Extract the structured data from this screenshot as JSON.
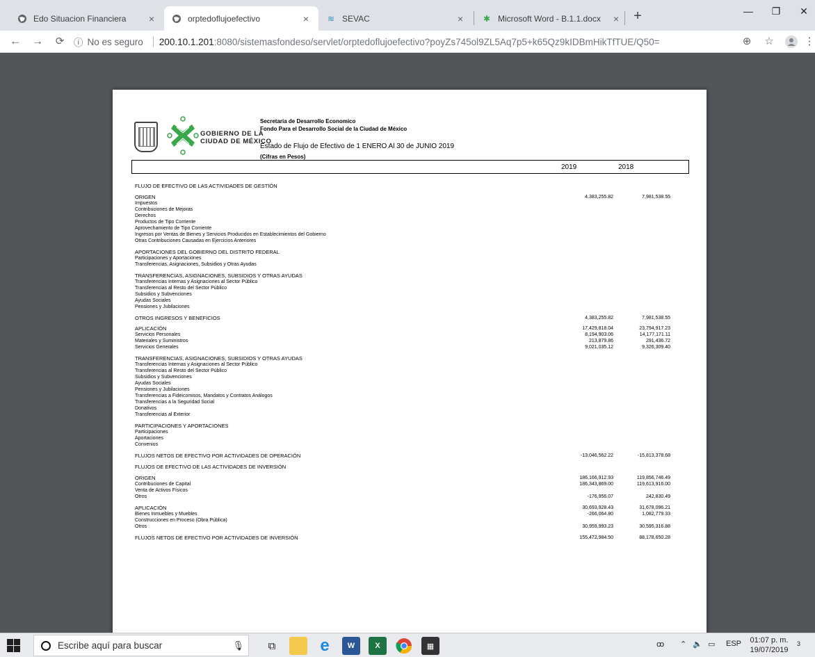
{
  "browser": {
    "tabs": [
      {
        "label": "Edo Situacion Financiera",
        "active": false
      },
      {
        "label": "orptedoflujoefectivo",
        "active": true
      },
      {
        "label": "SEVAC",
        "active": false
      },
      {
        "label": "Microsoft Word - B.1.1.docx",
        "active": false
      }
    ],
    "security_label": "No es seguro",
    "url_host": "200.10.1.201",
    "url_rest": ":8080/sistemasfondeso/servlet/orptedoflujoefectivo?poyZs745ol9ZL5Aq7p5+k65Qz9kIDBmHikTfTUE/Q50="
  },
  "report": {
    "logo_text_line1": "GOBIERNO DE LA",
    "logo_text_line2": "CIUDAD DE MÉXICO",
    "header_line1": "Secretaria de Desarrollo Economico",
    "header_line2": "Fondo Para el Desarrollo Social de la Ciudad de México",
    "title": "Estado de Flujo de Efectivo de 1 ENERO Al 30 de JUNIO 2019",
    "subtitle": "(Cifras en Pesos)",
    "year_current": "2019",
    "year_previous": "2018",
    "rows": [
      {
        "label": "FLUJO DE EFECTIVO DE LAS ACTIVIDADES DE GESTIÓN",
        "v2019": "",
        "v2018": "",
        "heading": true
      },
      {
        "label": "ORIGEN",
        "v2019": "4,383,255.82",
        "v2018": "7,981,538.55",
        "heading": true
      },
      {
        "label": "Impuestos",
        "v2019": "",
        "v2018": ""
      },
      {
        "label": "Contribuciones de Mejoras",
        "v2019": "",
        "v2018": ""
      },
      {
        "label": "Derechos",
        "v2019": "",
        "v2018": ""
      },
      {
        "label": "Productos de Tipo Corriente",
        "v2019": "",
        "v2018": ""
      },
      {
        "label": "Aprovechamiento de Tipo Corriente",
        "v2019": "",
        "v2018": ""
      },
      {
        "label": "Ingresos por Ventas de Bienes y Servicios Producidos en Establecimientos del Gobierno",
        "v2019": "",
        "v2018": ""
      },
      {
        "label": "Otras Contribuciones Causadas en Ejercicios Anteriores",
        "v2019": "",
        "v2018": ""
      },
      {
        "label": "APORTACIONES DEL GOBIERNO DEL DISTRITO FEDERAL",
        "v2019": "",
        "v2018": "",
        "heading": true
      },
      {
        "label": "Participaciones y Aportaciones",
        "v2019": "",
        "v2018": ""
      },
      {
        "label": "Transferencias, Asignaciones, Subsidios y Otras Ayudas",
        "v2019": "",
        "v2018": ""
      },
      {
        "label": "TRANSFERENCIAS, ASIGNACIONES, SUBSIDIOS Y OTRAS AYUDAS",
        "v2019": "",
        "v2018": "",
        "heading": true
      },
      {
        "label": "Transferencias Internas y Asignaciones al Sector Público",
        "v2019": "",
        "v2018": ""
      },
      {
        "label": "Transferencias al Resto del Sector Público",
        "v2019": "",
        "v2018": ""
      },
      {
        "label": "Subsidios y Subvenciones",
        "v2019": "",
        "v2018": ""
      },
      {
        "label": "Ayudas Sociales",
        "v2019": "",
        "v2018": ""
      },
      {
        "label": "Pensiones y Jubilaciones",
        "v2019": "",
        "v2018": ""
      },
      {
        "label": "OTROS INGRESOS Y BENEFICIOS",
        "v2019": "4,383,255.82",
        "v2018": "7,981,538.55",
        "heading": true
      },
      {
        "label": "APLICACIÓN",
        "v2019": "17,429,818.04",
        "v2018": "23,794,917.23",
        "heading": true
      },
      {
        "label": "Servicios Personales",
        "v2019": "8,194,903.06",
        "v2018": "14,177,171.11"
      },
      {
        "label": "Materiales y Suministros",
        "v2019": "213,879.86",
        "v2018": "291,436.72"
      },
      {
        "label": "Servicios Generales",
        "v2019": "9,021,035.12",
        "v2018": "9,326,309.40"
      },
      {
        "label": "TRANSFERENCIAS, ASIGNACIONES, SUBSIDIOS Y OTRAS AYUDAS",
        "v2019": "",
        "v2018": "",
        "heading": true
      },
      {
        "label": "Transferencias Internas y Asignaciones al Sector Público",
        "v2019": "",
        "v2018": ""
      },
      {
        "label": "Transferencias al Resto del Sector Público",
        "v2019": "",
        "v2018": ""
      },
      {
        "label": "Subsidios y Subvenciones",
        "v2019": "",
        "v2018": ""
      },
      {
        "label": "Ayudas Sociales",
        "v2019": "",
        "v2018": ""
      },
      {
        "label": "Pensiones y Jubilaciones",
        "v2019": "",
        "v2018": ""
      },
      {
        "label": "Transferencias a Fideicomisos, Mandatos y Contratos Análogos",
        "v2019": "",
        "v2018": ""
      },
      {
        "label": "Transferencias a la Seguridad Social",
        "v2019": "",
        "v2018": ""
      },
      {
        "label": "Donativos",
        "v2019": "",
        "v2018": ""
      },
      {
        "label": "Transferencias al Exterior",
        "v2019": "",
        "v2018": ""
      },
      {
        "label": "PARTICIPACIONES Y APORTACIONES",
        "v2019": "",
        "v2018": "",
        "heading": true
      },
      {
        "label": "Participaciones",
        "v2019": "",
        "v2018": ""
      },
      {
        "label": "Aportaciones",
        "v2019": "",
        "v2018": ""
      },
      {
        "label": "Convenios",
        "v2019": "",
        "v2018": ""
      },
      {
        "label": "FLUJOS NETOS DE EFECTIVO POR ACTIVIDADES DE OPERACIÓN",
        "v2019": "-13,046,562.22",
        "v2018": "-15,813,378.68",
        "heading": true
      },
      {
        "label": "FLUJOS DE EFECTIVO DE LAS ACTIVIDADES DE INVERSIÓN",
        "v2019": "",
        "v2018": "",
        "heading": true
      },
      {
        "label": "ORIGEN",
        "v2019": "186,166,912.93",
        "v2018": "119,856,746.49",
        "heading": true
      },
      {
        "label": "Contribuciones de Capital",
        "v2019": "186,343,869.00",
        "v2018": "119,613,916.00"
      },
      {
        "label": "Venta de Activos Físicos",
        "v2019": "",
        "v2018": ""
      },
      {
        "label": "Otros",
        "v2019": "-176,956.07",
        "v2018": "242,830.49"
      },
      {
        "label": "APLICACIÓN",
        "v2019": "30,693,928.43",
        "v2018": "31,678,096.21",
        "heading": true
      },
      {
        "label": "Bienes Inmuebles y Muebles",
        "v2019": "-266,064.80",
        "v2018": "1,082,779.33"
      },
      {
        "label": "Construcciones en Proceso (Obra Pública)",
        "v2019": "",
        "v2018": ""
      },
      {
        "label": "Otros",
        "v2019": "30,959,993.23",
        "v2018": "30,595,316.88"
      },
      {
        "label": "FLUJOS NETOS DE EFECTIVO POR ACTIVIDADES DE INVERSIÓN",
        "v2019": "155,472,984.50",
        "v2018": "88,178,650.28",
        "heading": true
      }
    ]
  },
  "taskbar": {
    "search_placeholder": "Escribe aquí para buscar",
    "language": "ESP",
    "time": "01:07 p. m.",
    "date": "19/07/2019",
    "notification_count": "3"
  }
}
